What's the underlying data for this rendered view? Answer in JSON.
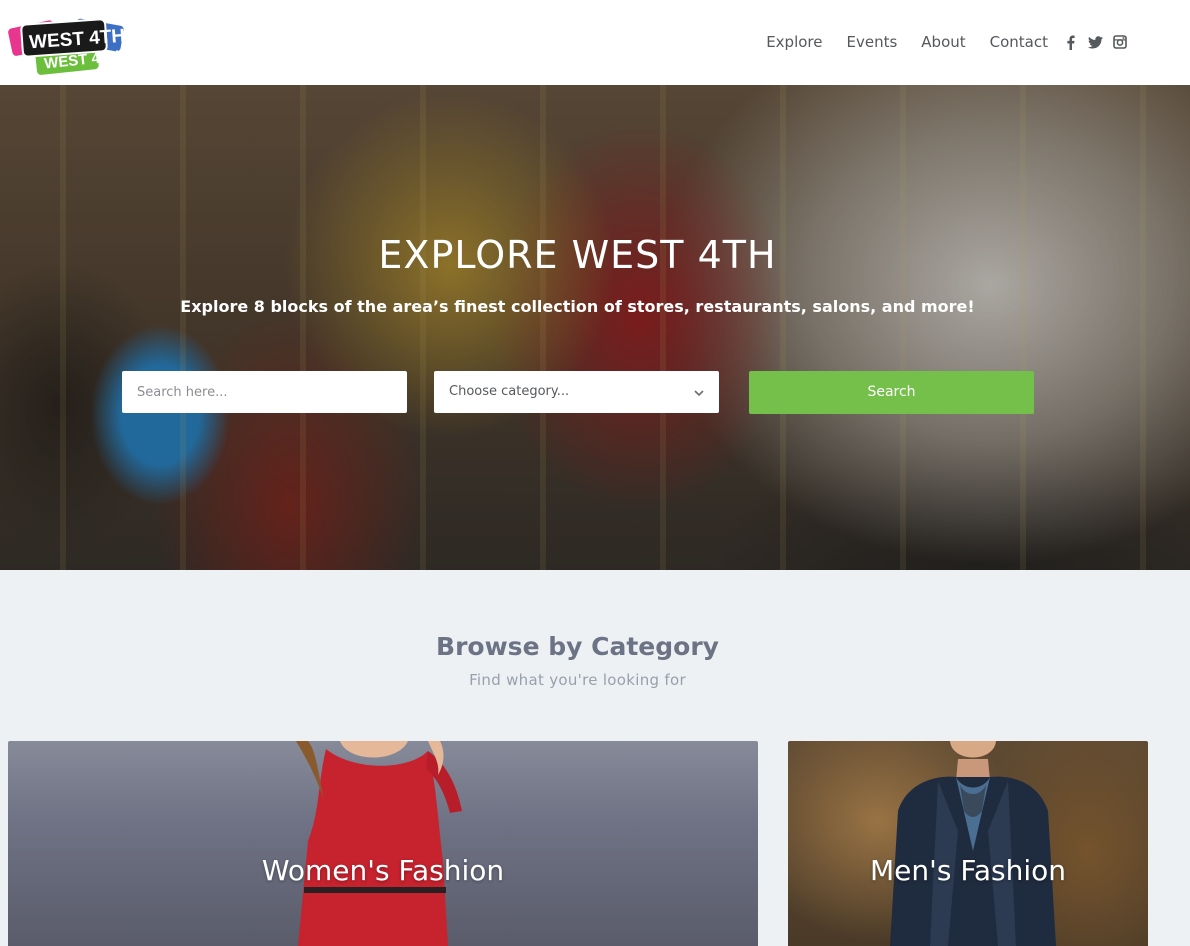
{
  "brand": {
    "logo_text": "WEST 4TH",
    "colors": {
      "pink": "#e8368f",
      "blue": "#3d6fc4",
      "green": "#6cbf3d",
      "black": "#1a1a1a"
    }
  },
  "nav": {
    "items": [
      {
        "label": "Explore"
      },
      {
        "label": "Events"
      },
      {
        "label": "About"
      },
      {
        "label": "Contact"
      }
    ],
    "social": [
      "facebook-icon",
      "twitter-icon",
      "instagram-icon"
    ]
  },
  "hero": {
    "title": "EXPLORE WEST 4TH",
    "subtitle": "Explore 8 blocks of the area’s finest collection of stores, restaurants, salons, and more!",
    "search": {
      "placeholder": "Search here...",
      "value": ""
    },
    "category": {
      "selected": "Choose category..."
    },
    "search_button": "Search",
    "accent": "#74c04b"
  },
  "browse": {
    "title": "Browse by Category",
    "subtitle": "Find what you're looking for",
    "categories": [
      {
        "label": "Women's Fashion"
      },
      {
        "label": "Men's Fashion"
      }
    ]
  }
}
